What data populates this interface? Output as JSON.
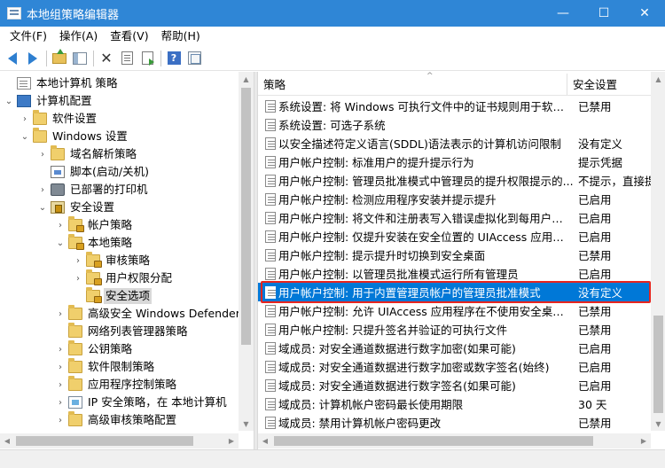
{
  "window": {
    "title": "本地组策略编辑器",
    "minimize_glyph": "—",
    "maximize_glyph": "☐",
    "close_glyph": "✕"
  },
  "menu": [
    "文件(F)",
    "操作(A)",
    "查看(V)",
    "帮助(H)"
  ],
  "toolbar": {
    "icons": [
      "back-arrow-icon",
      "forward-arrow-icon",
      "up-folder-icon",
      "show-hide-tree-icon",
      "delete-icon",
      "properties-icon",
      "export-list-icon",
      "help-icon",
      "view-icon"
    ],
    "delete_glyph": "✕",
    "help_glyph": "?"
  },
  "tree": {
    "items": [
      {
        "label": "本地计算机 策略",
        "expander": ""
      },
      {
        "label": "计算机配置",
        "expander": "⌄"
      },
      {
        "label": "软件设置",
        "expander": "›"
      },
      {
        "label": "Windows 设置",
        "expander": "⌄"
      },
      {
        "label": "域名解析策略",
        "expander": "›"
      },
      {
        "label": "脚本(启动/关机)",
        "expander": ""
      },
      {
        "label": "已部署的打印机",
        "expander": "›"
      },
      {
        "label": "安全设置",
        "expander": "⌄"
      },
      {
        "label": "帐户策略",
        "expander": "›"
      },
      {
        "label": "本地策略",
        "expander": "⌄"
      },
      {
        "label": "审核策略",
        "expander": "›"
      },
      {
        "label": "用户权限分配",
        "expander": "›"
      },
      {
        "label": "安全选项",
        "expander": ""
      },
      {
        "label": "高级安全 Windows Defender",
        "expander": "›"
      },
      {
        "label": "网络列表管理器策略",
        "expander": ""
      },
      {
        "label": "公钥策略",
        "expander": "›"
      },
      {
        "label": "软件限制策略",
        "expander": "›"
      },
      {
        "label": "应用程序控制策略",
        "expander": "›"
      },
      {
        "label": "IP 安全策略，在 本地计算机",
        "expander": "›"
      },
      {
        "label": "高级审核策略配置",
        "expander": "›"
      }
    ]
  },
  "scroll_glyphs": {
    "up": "▲",
    "down": "▼",
    "left": "◀",
    "right": "▶"
  },
  "list": {
    "columns": {
      "policy": "策略",
      "setting": "安全设置"
    },
    "sort_caret": "^",
    "rows": [
      {
        "name": "系统设置: 将 Windows 可执行文件中的证书规则用于软件...",
        "value": "已禁用"
      },
      {
        "name": "系统设置: 可选子系统",
        "value": ""
      },
      {
        "name": "以安全描述符定义语言(SDDL)语法表示的计算机访问限制",
        "value": "没有定义"
      },
      {
        "name": "用户帐户控制: 标准用户的提升提示行为",
        "value": "提示凭据"
      },
      {
        "name": "用户帐户控制: 管理员批准模式中管理员的提升权限提示的...",
        "value": "不提示，直接提"
      },
      {
        "name": "用户帐户控制: 检测应用程序安装并提示提升",
        "value": "已启用"
      },
      {
        "name": "用户帐户控制: 将文件和注册表写入错误虚拟化到每用户位置",
        "value": "已启用"
      },
      {
        "name": "用户帐户控制: 仅提升安装在安全位置的 UIAccess 应用程序",
        "value": "已启用"
      },
      {
        "name": "用户帐户控制: 提示提升时切换到安全桌面",
        "value": "已禁用"
      },
      {
        "name": "用户帐户控制: 以管理员批准模式运行所有管理员",
        "value": "已启用"
      },
      {
        "name": "用户帐户控制: 用于内置管理员帐户的管理员批准模式",
        "value": "没有定义"
      },
      {
        "name": "用户帐户控制: 允许 UIAccess 应用程序在不使用安全桌面...",
        "value": "已禁用"
      },
      {
        "name": "用户帐户控制: 只提升签名并验证的可执行文件",
        "value": "已禁用"
      },
      {
        "name": "域成员: 对安全通道数据进行数字加密(如果可能)",
        "value": "已启用"
      },
      {
        "name": "域成员: 对安全通道数据进行数字加密或数字签名(始终)",
        "value": "已启用"
      },
      {
        "name": "域成员: 对安全通道数据进行数字签名(如果可能)",
        "value": "已启用"
      },
      {
        "name": "域成员: 计算机帐户密码最长使用期限",
        "value": "30 天"
      },
      {
        "name": "域成员: 禁用计算机帐户密码更改",
        "value": "已禁用"
      }
    ]
  },
  "colors": {
    "titlebar": "#2f86d6",
    "selection": "#0078d7",
    "highlight_box": "#e8251e"
  }
}
